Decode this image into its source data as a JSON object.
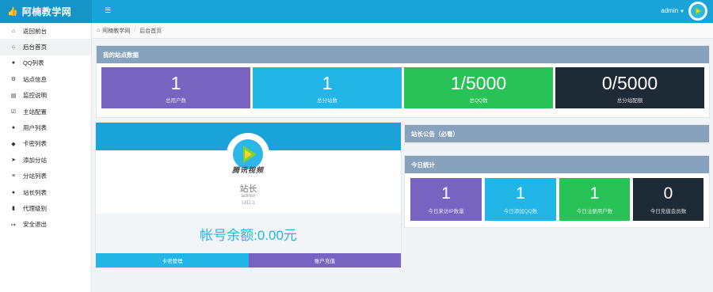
{
  "header": {
    "brand": "阿楠教学网",
    "toggle_icon": "☰",
    "user": "admin"
  },
  "sidebar": {
    "items": [
      {
        "icon": "home-icon",
        "glyph": "⌂",
        "label": "返回前台"
      },
      {
        "icon": "home-icon",
        "glyph": "⌂",
        "label": "后台首页"
      },
      {
        "icon": "qq-icon",
        "glyph": "●",
        "label": "QQ列表"
      },
      {
        "icon": "cogs-icon",
        "glyph": "⚙",
        "label": "站点信息"
      },
      {
        "icon": "list-alt-icon",
        "glyph": "▤",
        "label": "监控说明"
      },
      {
        "icon": "check-square-icon",
        "glyph": "☑",
        "label": "主站配置"
      },
      {
        "icon": "user-icon",
        "glyph": "●",
        "label": "用户列表"
      },
      {
        "icon": "tags-icon",
        "glyph": "◆",
        "label": "卡密列表"
      },
      {
        "icon": "location-arrow-icon",
        "glyph": "➤",
        "label": "添加分站"
      },
      {
        "icon": "list-icon",
        "glyph": "≡",
        "label": "分站列表"
      },
      {
        "icon": "users-icon",
        "glyph": "●",
        "label": "站长列表"
      },
      {
        "icon": "male-icon",
        "glyph": "▮",
        "label": "代理级别"
      },
      {
        "icon": "sign-out-icon",
        "glyph": "↦",
        "label": "安全退出"
      }
    ]
  },
  "breadcrumb": {
    "home": "阿楠教学网",
    "current": "后台首页"
  },
  "site_data": {
    "title": "我的站点数据",
    "stats": [
      {
        "value": "1",
        "label": "总用户数",
        "color": "#7764c0"
      },
      {
        "value": "1",
        "label": "总分站数",
        "color": "#22b6e6"
      },
      {
        "value": "1/5000",
        "label": "总QQ数",
        "color": "#29c257"
      },
      {
        "value": "0/5000",
        "label": "总分站配额",
        "color": "#1f2a37"
      }
    ]
  },
  "profile": {
    "avatar_caption": "腾讯视频",
    "role": "站长",
    "username": "admin",
    "uid": "UID:1",
    "balance": "帐号余额:0.00元",
    "buttons": {
      "left": "卡密管理",
      "right": "账户充值"
    }
  },
  "notice": {
    "title": "站长公告（必看）"
  },
  "today": {
    "title": "今日统计",
    "stats": [
      {
        "value": "1",
        "label": "今日来访IP数量",
        "color": "#7764c0"
      },
      {
        "value": "1",
        "label": "今日添加QQ数",
        "color": "#22b6e6"
      },
      {
        "value": "1",
        "label": "今日注册用户数",
        "color": "#29c257"
      },
      {
        "value": "0",
        "label": "今日充值会员数",
        "color": "#1f2a37"
      }
    ]
  }
}
